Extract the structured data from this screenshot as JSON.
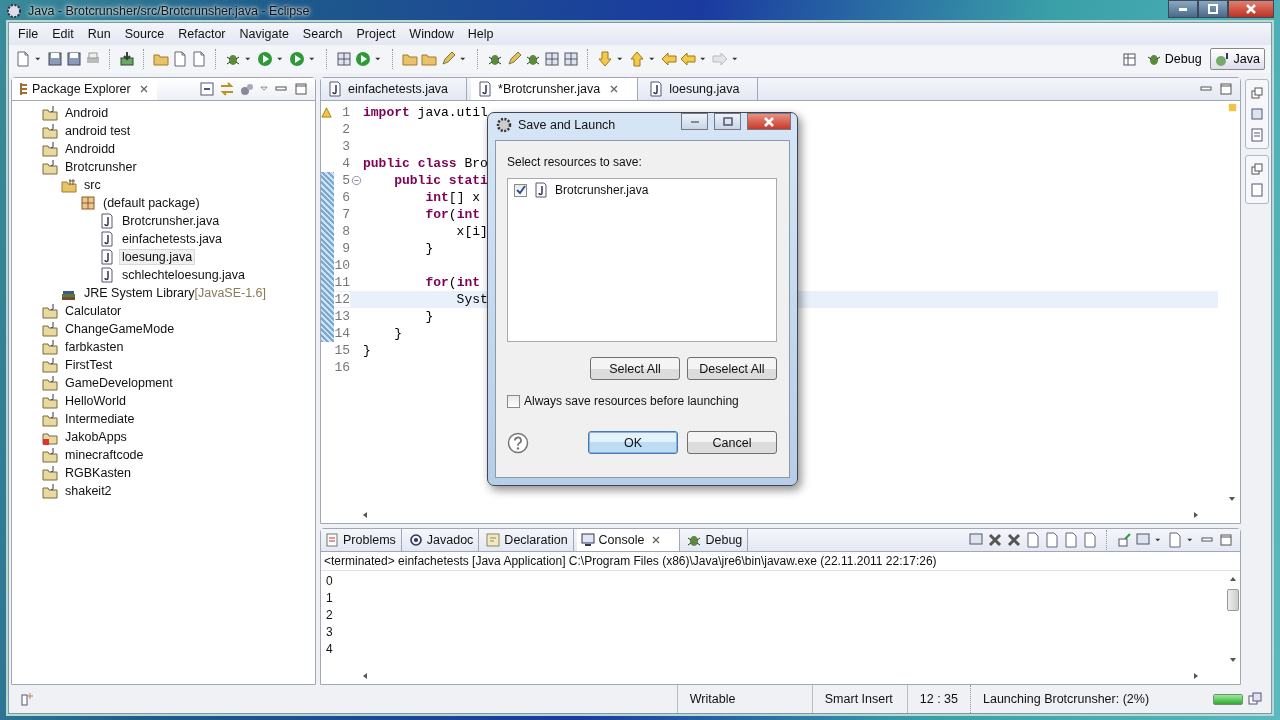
{
  "window": {
    "title": "Java - Brotcrunsher/src/Brotcrunsher.java - Eclipse"
  },
  "menu": [
    "File",
    "Edit",
    "Run",
    "Source",
    "Refactor",
    "Navigate",
    "Search",
    "Project",
    "Window",
    "Help"
  ],
  "perspectives": [
    {
      "label": "Debug",
      "selected": false
    },
    {
      "label": "Java",
      "selected": true
    }
  ],
  "package_explorer": {
    "title": "Package Explorer",
    "tree": [
      {
        "label": "Android",
        "kind": "project",
        "selected": false
      },
      {
        "label": "android test",
        "kind": "project",
        "selected": false
      },
      {
        "label": "Androidd",
        "kind": "project",
        "selected": false
      },
      {
        "label": "Brotcrunsher",
        "kind": "project",
        "selected": false,
        "children": [
          {
            "label": "src",
            "kind": "source",
            "selected": false,
            "children": [
              {
                "label": "(default package)",
                "kind": "package",
                "selected": false,
                "children": [
                  {
                    "label": "Brotcrunsher.java",
                    "kind": "file",
                    "selected": false
                  },
                  {
                    "label": "einfachetests.java",
                    "kind": "file",
                    "selected": false
                  },
                  {
                    "label": "loesung.java",
                    "kind": "file",
                    "selected": true
                  },
                  {
                    "label": "schlechteloesung.java",
                    "kind": "file",
                    "selected": false
                  }
                ]
              }
            ]
          },
          {
            "label": "JRE System Library",
            "suffix": "[JavaSE-1.6]",
            "kind": "library",
            "selected": false
          }
        ]
      },
      {
        "label": "Calculator",
        "kind": "project",
        "selected": false
      },
      {
        "label": "ChangeGameMode",
        "kind": "project",
        "selected": false
      },
      {
        "label": "farbkasten",
        "kind": "project",
        "selected": false
      },
      {
        "label": "FirstTest",
        "kind": "project",
        "selected": false
      },
      {
        "label": "GameDevelopment",
        "kind": "project",
        "selected": false
      },
      {
        "label": "HelloWorld",
        "kind": "project",
        "selected": false
      },
      {
        "label": "Intermediate",
        "kind": "project",
        "selected": false
      },
      {
        "label": "JakobApps",
        "kind": "error_project",
        "selected": false
      },
      {
        "label": "minecraftcode",
        "kind": "project",
        "selected": false
      },
      {
        "label": "RGBKasten",
        "kind": "project",
        "selected": false
      },
      {
        "label": "shakeit2",
        "kind": "project",
        "selected": false
      }
    ]
  },
  "editor": {
    "tabs": [
      {
        "label": "einfachetests.java",
        "selected": false
      },
      {
        "label": "*Brotcrunsher.java",
        "selected": true
      },
      {
        "label": "loesung.java",
        "selected": false
      }
    ],
    "lines": [
      {
        "number": "1",
        "text": "**import** java.util",
        "warning": true,
        "collapsible": false,
        "changed": false,
        "current": false
      },
      {
        "number": "2",
        "warning": false,
        "collapsible": false,
        "changed": false,
        "current": false
      },
      {
        "number": "3",
        "warning": false,
        "collapsible": false,
        "changed": false,
        "current": false
      },
      {
        "number": "4",
        "text": "**public** **class** Bro",
        "warning": false,
        "collapsible": false,
        "changed": false,
        "current": false
      },
      {
        "number": "5",
        "text": "    **public** **stati**",
        "warning": false,
        "collapsible": true,
        "changed": true,
        "current": false
      },
      {
        "number": "6",
        "text": "        **int**[] x",
        "warning": false,
        "collapsible": false,
        "changed": true,
        "current": false
      },
      {
        "number": "7",
        "text": "        **for**(**int**",
        "warning": false,
        "collapsible": false,
        "changed": true,
        "current": false
      },
      {
        "number": "8",
        "text": "            x[i]",
        "warning": false,
        "collapsible": false,
        "changed": true,
        "current": false
      },
      {
        "number": "9",
        "text": "        }",
        "warning": false,
        "collapsible": false,
        "changed": true,
        "current": false
      },
      {
        "number": "10",
        "warning": false,
        "collapsible": false,
        "changed": true,
        "current": false
      },
      {
        "number": "11",
        "text": "        **for**(**int**",
        "warning": false,
        "collapsible": false,
        "changed": true,
        "current": false
      },
      {
        "number": "12",
        "text": "            Syst",
        "warning": false,
        "collapsible": false,
        "changed": true,
        "current": true
      },
      {
        "number": "13",
        "text": "        }",
        "warning": false,
        "collapsible": false,
        "changed": true,
        "current": false
      },
      {
        "number": "14",
        "text": "    }",
        "warning": false,
        "collapsible": false,
        "changed": true,
        "current": false
      },
      {
        "number": "15",
        "text": "}",
        "warning": false,
        "collapsible": false,
        "changed": false,
        "current": false
      },
      {
        "number": "16",
        "warning": false,
        "collapsible": false,
        "changed": false,
        "current": false
      }
    ]
  },
  "dialog": {
    "title": "Save and Launch",
    "prompt": "Select resources to save:",
    "resources": [
      {
        "label": "Brotcrunsher.java",
        "checked": true
      }
    ],
    "select_all": "Select All",
    "deselect_all": "Deselect All",
    "always_save": {
      "label": "Always save resources before launching",
      "checked": false
    },
    "ok": "OK",
    "cancel": "Cancel"
  },
  "console": {
    "tabs": [
      {
        "label": "Problems",
        "kind": "problems",
        "selected": false
      },
      {
        "label": "Javadoc",
        "kind": "javadoc",
        "selected": false
      },
      {
        "label": "Declaration",
        "kind": "declaration",
        "selected": false
      },
      {
        "label": "Console",
        "kind": "console",
        "selected": true
      },
      {
        "label": "Debug",
        "kind": "debug",
        "selected": false
      }
    ],
    "header": "<terminated> einfachetests [Java Application] C:\\Program Files (x86)\\Java\\jre6\\bin\\javaw.exe (22.11.2011 22:17:26)",
    "lines": [
      "0",
      "1",
      "2",
      "3",
      "4"
    ]
  },
  "status": {
    "fields": [
      "Writable",
      "Smart Insert",
      "12 : 35"
    ],
    "progress_label": "Launching Brotcrunsher: (2%)",
    "level": 1
  }
}
